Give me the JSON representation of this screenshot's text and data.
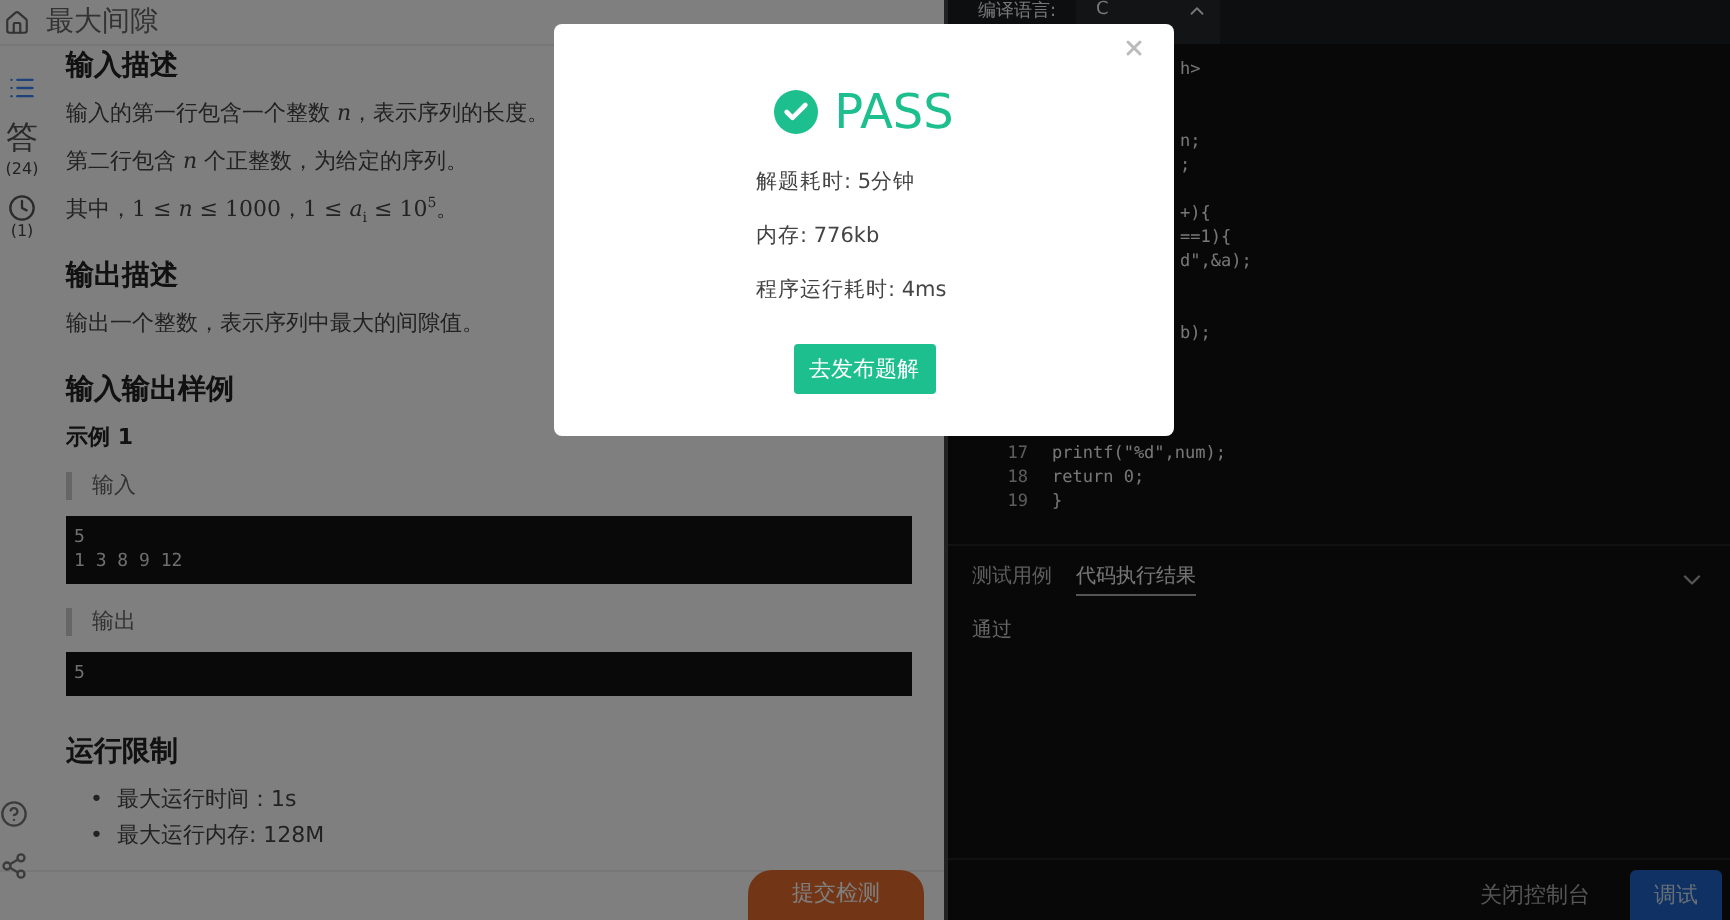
{
  "problem": {
    "title": "最大间隙",
    "rail": [
      {
        "kind": "list",
        "selected": true
      },
      {
        "kind": "answer",
        "label": "答",
        "count": "(24)",
        "selected": false
      },
      {
        "kind": "history",
        "count": "(1)",
        "selected": false
      }
    ],
    "sections": [
      {
        "kind": "heading",
        "text": "输入描述"
      },
      {
        "kind": "para",
        "text": "输入的第一行包含一个整数 *n*，表示序列的长度。"
      },
      {
        "kind": "para",
        "text": "第二行包含 *n* 个正整数，为给定的序列。"
      },
      {
        "kind": "para",
        "text": "其中，1 ≤ *n* ≤ 1000，1 ≤ *a*$_{i}$ ≤ 10$^{5}$。"
      },
      {
        "kind": "heading",
        "text": "输出描述"
      },
      {
        "kind": "para",
        "text": "输出一个整数，表示序列中最大的间隙值。"
      },
      {
        "kind": "heading",
        "text": "输入输出样例"
      },
      {
        "kind": "subheading",
        "text": "示例 1"
      },
      {
        "kind": "quote",
        "text": "输入"
      },
      {
        "kind": "code",
        "lines": [
          "5",
          "1 3 8 9 12"
        ]
      },
      {
        "kind": "quote",
        "text": "输出"
      },
      {
        "kind": "code",
        "lines": [
          "5"
        ]
      },
      {
        "kind": "heading",
        "text": "运行限制"
      },
      {
        "kind": "bullets",
        "items": [
          {
            "marker": "•",
            "text": "最大运行时间：1s"
          },
          {
            "marker": "•",
            "text": "最大运行内存: 128M"
          }
        ]
      }
    ],
    "submit_button": "提交检测"
  },
  "editor": {
    "language_label": "编译语言:",
    "language": "C",
    "lines": [
      {
        "kind": "partial",
        "text": "h>"
      },
      {
        "kind": "blank"
      },
      {
        "kind": "blank"
      },
      {
        "kind": "partial",
        "text": "n;"
      },
      {
        "kind": "partial",
        "text": ";"
      },
      {
        "kind": "blank"
      },
      {
        "kind": "partial",
        "text": "+){"
      },
      {
        "kind": "partial",
        "text": "==1){"
      },
      {
        "kind": "partial",
        "text": "d\",&a);"
      },
      {
        "kind": "blank"
      },
      {
        "kind": "blank"
      },
      {
        "kind": "partial",
        "text": "b);"
      },
      {
        "kind": "blank"
      },
      {
        "kind": "blank"
      },
      {
        "kind": "blank"
      },
      {
        "kind": "blank"
      },
      {
        "kind": "full",
        "number": "17",
        "text": "printf(\"%d\",num);"
      },
      {
        "kind": "full",
        "number": "18",
        "text": "return 0;"
      },
      {
        "kind": "full",
        "number": "19",
        "text": "}"
      }
    ]
  },
  "console": {
    "tabs": [
      {
        "label": "测试用例",
        "selected": false
      },
      {
        "label": "代码执行结果",
        "selected": true
      }
    ],
    "result": "通过",
    "buttons": [
      "关闭控制台",
      "调试"
    ]
  },
  "dialog": {
    "status": "PASS",
    "stats": [
      "解题耗时: 5分钟",
      "内存: 776kb",
      "程序运行耗时: 4ms"
    ],
    "button": "去发布题解"
  }
}
